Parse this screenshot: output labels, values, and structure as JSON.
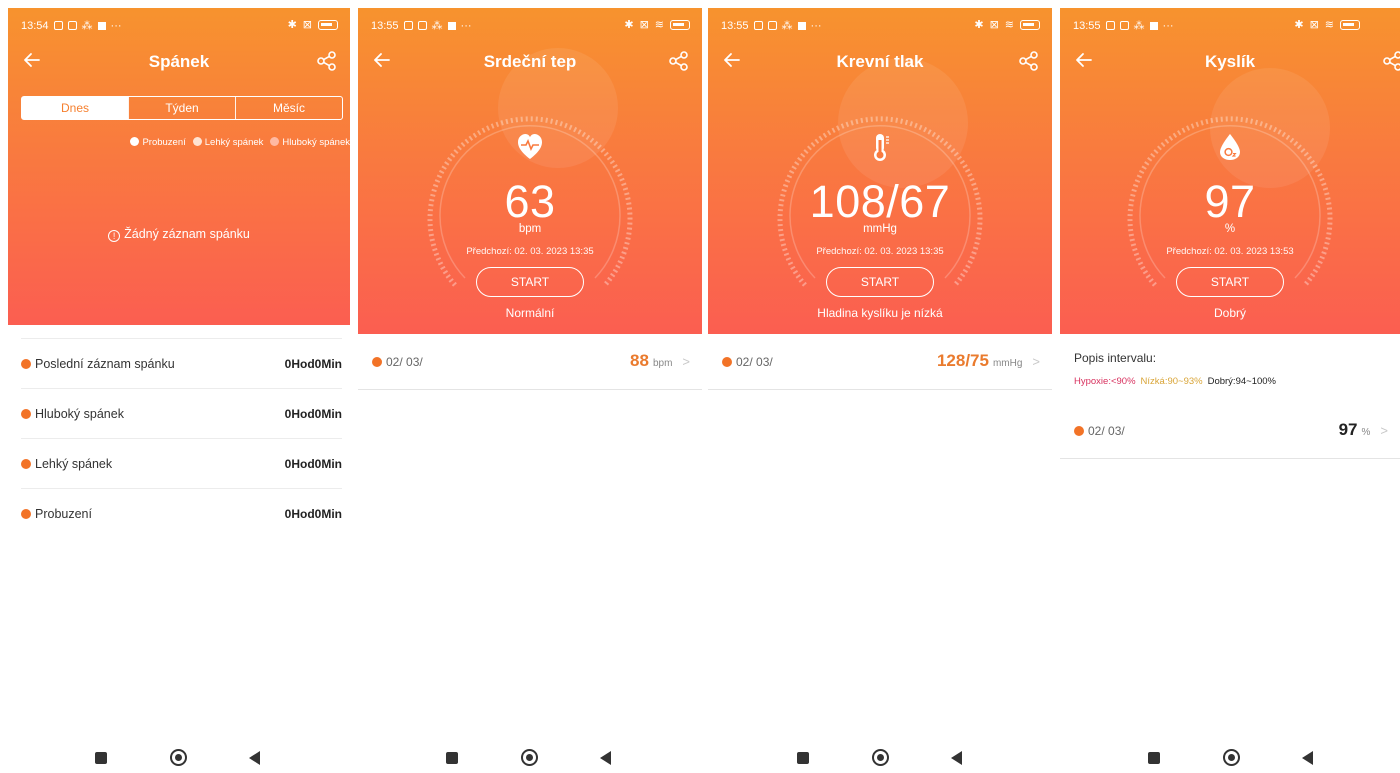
{
  "screens": [
    {
      "statusbar": {
        "time": "13:54"
      },
      "title": "Spánek",
      "tabs": [
        "Dnes",
        "Týden",
        "Měsíc"
      ],
      "legend": [
        {
          "label": "Probuzení",
          "color": "#ffffff"
        },
        {
          "label": "Lehký spánek",
          "color": "#ffe3d2"
        },
        {
          "label": "Hluboký spánek",
          "color": "#ffb9a2"
        }
      ],
      "empty_message": "Žádný záznam spánku",
      "rows": [
        {
          "label": "Poslední záznam spánku",
          "value": "0Hod0Min"
        },
        {
          "label": "Hluboký spánek",
          "value": "0Hod0Min"
        },
        {
          "label": "Lehký spánek",
          "value": "0Hod0Min"
        },
        {
          "label": "Probuzení",
          "value": "0Hod0Min"
        }
      ]
    },
    {
      "statusbar": {
        "time": "13:55"
      },
      "title": "Srdeční tep",
      "icon": "heart-pulse-icon",
      "value": "63",
      "unit": "bpm",
      "previous": "Předchozí:  02. 03. 2023 13:35",
      "start_label": "START",
      "status": "Normální",
      "record": {
        "date": "02/ 03/",
        "value": "88",
        "unit": "bpm"
      }
    },
    {
      "statusbar": {
        "time": "13:55"
      },
      "title": "Krevní tlak",
      "icon": "thermometer-icon",
      "value": "108/67",
      "unit": "mmHg",
      "previous": "Předchozí:  02. 03. 2023 13:35",
      "start_label": "START",
      "status": "Hladina kyslíku je nízká",
      "record": {
        "date": "02/ 03/",
        "value": "128/75",
        "unit": "mmHg"
      }
    },
    {
      "statusbar": {
        "time": "13:55"
      },
      "title": "Kyslík",
      "icon": "oxygen-drop-icon",
      "value": "97",
      "unit": "%",
      "previous": "Předchozí:  02. 03. 2023 13:53",
      "start_label": "START",
      "status": "Dobrý",
      "interval": {
        "title": "Popis intervalu:",
        "hypoxia": "Hypoxie:<90%",
        "low": "Nízká:90~93%",
        "good": "Dobrý:94~100%"
      },
      "record": {
        "date": "02/ 03/",
        "value": "97",
        "unit": "%"
      }
    }
  ],
  "colors": {
    "accent": "#f6802f",
    "dot": "#f27327",
    "hypoxia": "#d8325f",
    "low": "#d9a538"
  }
}
